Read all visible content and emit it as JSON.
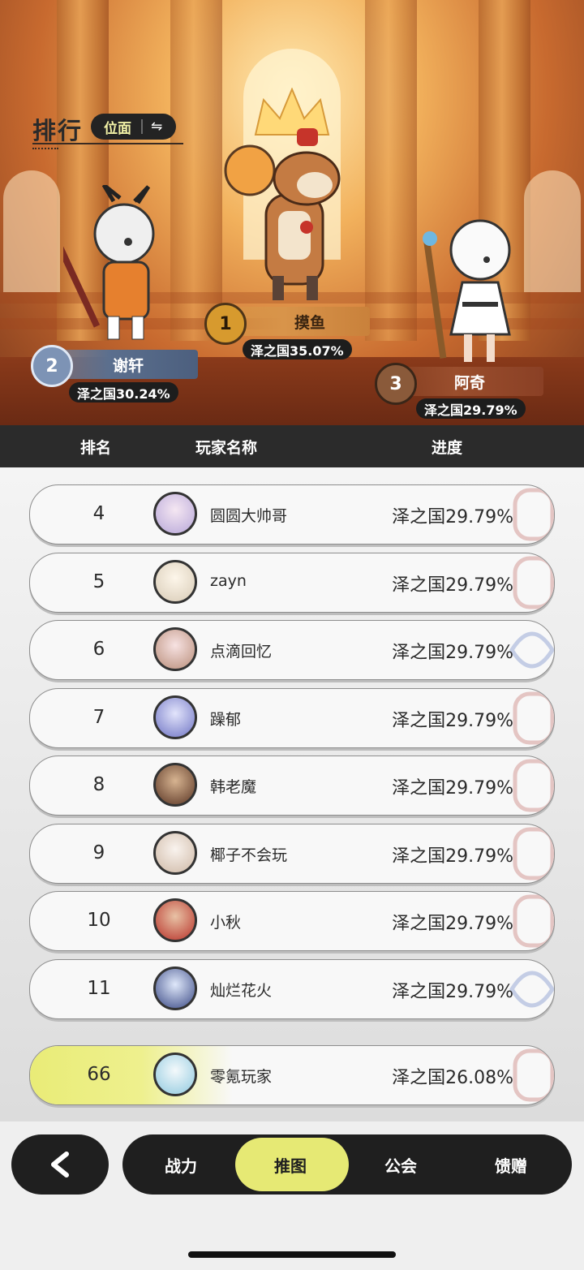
{
  "title": "排行",
  "filter": {
    "label": "位面"
  },
  "colors": {
    "accent": "#e6e974",
    "dark": "#1f1f1f"
  },
  "podium": [
    {
      "rank": "1",
      "name": "摸鱼",
      "score": "泽之国35.07%"
    },
    {
      "rank": "2",
      "name": "谢轩",
      "score": "泽之国30.24%"
    },
    {
      "rank": "3",
      "name": "阿奇",
      "score": "泽之国29.79%"
    }
  ],
  "table_header": {
    "rank": "排名",
    "player": "玩家名称",
    "progress": "进度"
  },
  "rows": [
    {
      "rank": "4",
      "name": "圆圆大帅哥",
      "progress": "泽之国29.79%"
    },
    {
      "rank": "5",
      "name": "zayn",
      "progress": "泽之国29.79%"
    },
    {
      "rank": "6",
      "name": "点滴回忆",
      "progress": "泽之国29.79%"
    },
    {
      "rank": "7",
      "name": "躁郁",
      "progress": "泽之国29.79%"
    },
    {
      "rank": "8",
      "name": "韩老魔",
      "progress": "泽之国29.79%"
    },
    {
      "rank": "9",
      "name": "椰子不会玩",
      "progress": "泽之国29.79%"
    },
    {
      "rank": "10",
      "name": "小秋",
      "progress": "泽之国29.79%"
    },
    {
      "rank": "11",
      "name": "灿烂花火",
      "progress": "泽之国29.79%"
    }
  ],
  "my_row": {
    "rank": "66",
    "name": "零氪玩家",
    "progress": "泽之国26.08%"
  },
  "tabs": [
    {
      "label": "战力"
    },
    {
      "label": "推图"
    },
    {
      "label": "公会"
    },
    {
      "label": "馈赠"
    }
  ]
}
